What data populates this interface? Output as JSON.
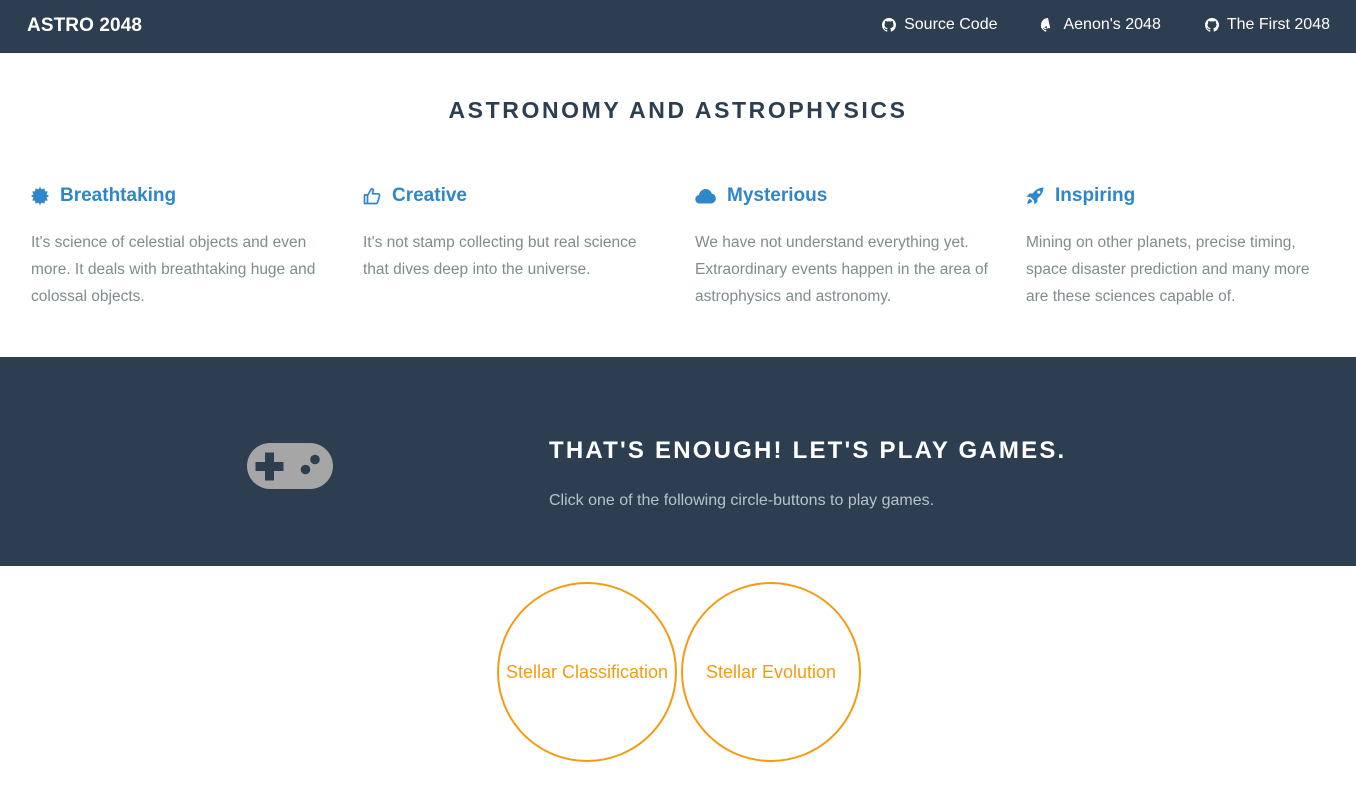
{
  "navbar": {
    "brand": "ASTRO 2048",
    "links": [
      {
        "label": "Source Code",
        "icon": "github-icon"
      },
      {
        "label": "Aenon's 2048",
        "icon": "github-icon"
      },
      {
        "label": "The First 2048",
        "icon": "github-icon"
      }
    ]
  },
  "intro": {
    "title": "ASTRONOMY AND ASTROPHYSICS",
    "features": [
      {
        "icon": "badge-icon",
        "title": "Breathtaking",
        "text": "It's science of celestial objects and even more. It deals with breathtaking huge and colossal objects."
      },
      {
        "icon": "thumbs-up-icon",
        "title": "Creative",
        "text": "It's not stamp collecting but real science that dives deep into the universe."
      },
      {
        "icon": "cloud-icon",
        "title": "Mysterious",
        "text": "We have not understand everything yet. Extraordinary events happen in the area of astrophysics and astronomy."
      },
      {
        "icon": "rocket-icon",
        "title": "Inspiring",
        "text": "Mining on other planets, precise timing, space disaster prediction and many more are these sciences capable of."
      }
    ]
  },
  "games": {
    "icon": "gamepad-icon",
    "title": "THAT'S ENOUGH! LET'S PLAY GAMES.",
    "text": "Click one of the following circle-buttons to play games.",
    "buttons": [
      {
        "label": "Stellar Classification"
      },
      {
        "label": "Stellar Evolution"
      }
    ]
  },
  "colors": {
    "navbar_bg": "#2c3e50",
    "accent_blue": "#2f86c8",
    "accent_orange": "#f39c12",
    "muted_text": "#7f8c8d"
  }
}
